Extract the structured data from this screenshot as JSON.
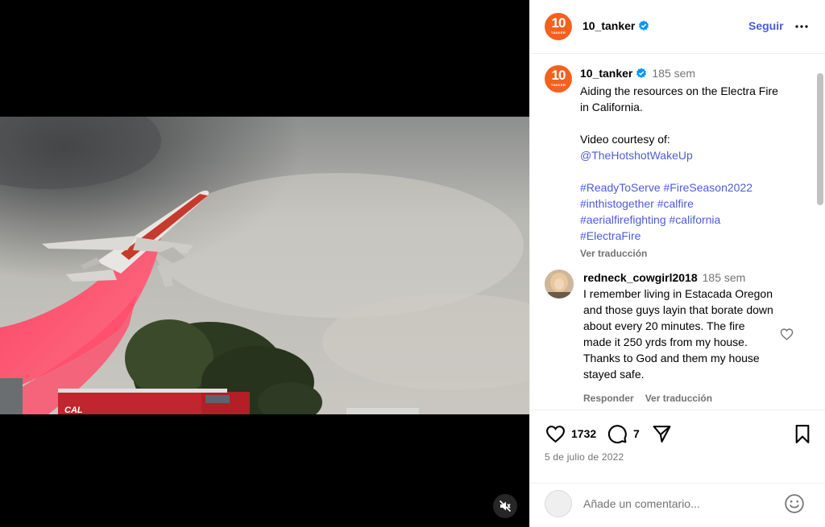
{
  "media": {
    "mute_icon": "muted-speaker-icon",
    "scene": {
      "truck_text": "CAL"
    }
  },
  "account": {
    "username": "10_tanker",
    "logo_number": "10",
    "logo_sub": "TANKER",
    "verified": true,
    "follow_label": "Seguir",
    "more_icon": "more-dots-icon"
  },
  "caption": {
    "username": "10_tanker",
    "time": "185 sem",
    "line1": "Aiding the resources on the Electra Fire",
    "line2": "in California.",
    "line3": "Video courtesy of:",
    "mention": "@TheHotshotWakeUp",
    "hashtags_1": "#ReadyToServe #FireSeason2022",
    "hashtags_2": "#inthistogether #calfire",
    "hashtags_3": "#aerialfirefighting #california",
    "hashtags_4": "#ElectraFire",
    "translate_label": "Ver traducción"
  },
  "comment": {
    "username": "redneck_cowgirl2018",
    "time": "185 sem",
    "text": "I remember living in Estacada Oregon and those guys layin that borate down about every 20 minutes. The fire made it 250 yrds from my house. Thanks to God and them my house stayed safe.",
    "reply_label": "Responder",
    "translate_label": "Ver traducción"
  },
  "actions": {
    "like_count": "1732",
    "comment_count": "7",
    "date": "5 de julio de 2022"
  },
  "add_comment": {
    "placeholder": "Añade un comentario..."
  },
  "colors": {
    "accent": "#4a5dd8",
    "brand_orange": "#f4611f",
    "verified_blue": "#0095f6",
    "muted_text": "#737373"
  }
}
